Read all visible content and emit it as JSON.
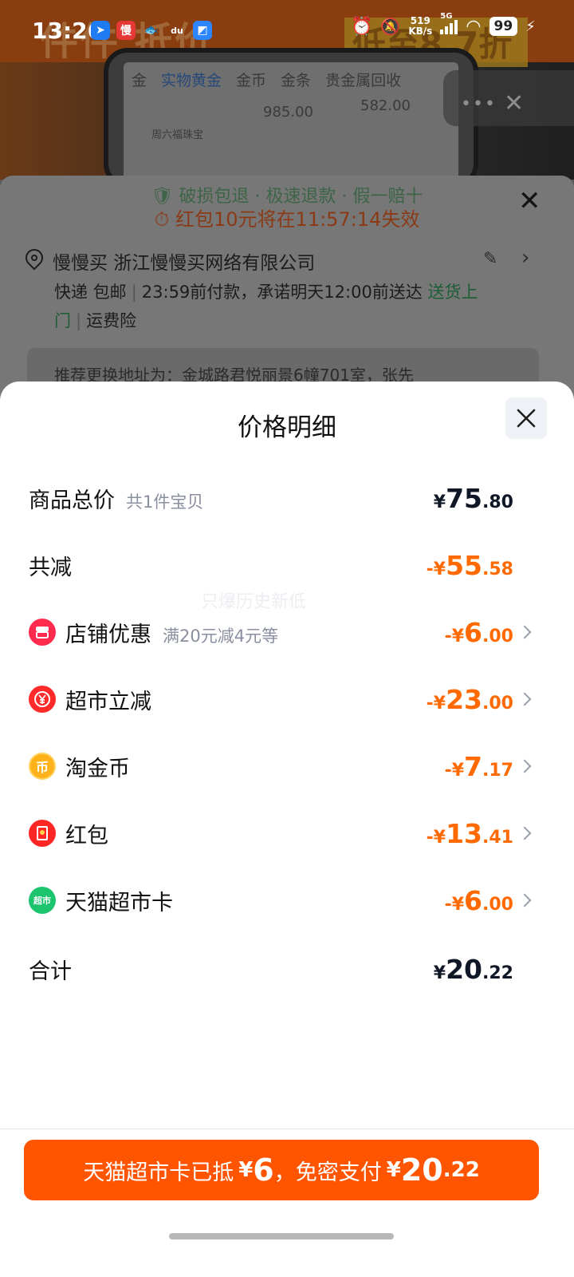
{
  "status_bar": {
    "time": "13:26",
    "net_speed_value": "519",
    "net_speed_unit": "KB/s",
    "network": "5G",
    "battery": "99",
    "app_icons": [
      "app-blue-icon",
      "man-man-mai-icon",
      "xianyu-icon",
      "du-icon",
      "blue-square-icon"
    ],
    "app_icon_texts": [
      "",
      "慢",
      "",
      "du",
      ""
    ]
  },
  "background": {
    "promo_left": "件件 抵价",
    "promo_right": "低至8.7折",
    "phone_tabs": [
      "金",
      "实物黄金",
      "金币",
      "金条",
      "贵金属回收"
    ],
    "phone_num1": "985.00",
    "phone_num2": "582.00",
    "phone_small": "周六福珠宝",
    "guarantee": "破损包退 · 极速退款 · 假一赔十",
    "timer": "红包10元将在11:57:14失效",
    "address": "慢慢买 浙江慢慢买网络有限公司",
    "delivery": {
      "carrier": "快递 包邮",
      "promise": "23:59前付款，承诺明天12:00前送达",
      "door_delivery": "送货上门",
      "insurance": "运费险"
    },
    "suggestion": "推荐更换地址为：金城路君悦丽景6幢701室，张先"
  },
  "sheet": {
    "title": "价格明细",
    "watermark": "只爆历史新低",
    "rows": [
      {
        "label": "商品总价",
        "sub": "共1件宝贝",
        "sign": "",
        "symbol": "¥",
        "int": "75",
        "dec": ".80"
      },
      {
        "label": "共减",
        "sub": "",
        "sign": "-",
        "symbol": "¥",
        "int": "55",
        "dec": ".58"
      },
      {
        "label": "店铺优惠",
        "sub": "满20元减4元等",
        "sign": "-",
        "symbol": "¥",
        "int": "6",
        "dec": ".00",
        "icon": "shop-icon"
      },
      {
        "label": "超市立减",
        "sub": "",
        "sign": "-",
        "symbol": "¥",
        "int": "23",
        "dec": ".00",
        "icon": "yuan-coupon-icon"
      },
      {
        "label": "淘金币",
        "sub": "",
        "sign": "-",
        "symbol": "¥",
        "int": "7",
        "dec": ".17",
        "icon": "taojinbi-coin-icon",
        "icon_text": "币"
      },
      {
        "label": "红包",
        "sub": "",
        "sign": "-",
        "symbol": "¥",
        "int": "13",
        "dec": ".41",
        "icon": "red-packet-icon"
      },
      {
        "label": "天猫超市卡",
        "sub": "",
        "sign": "-",
        "symbol": "¥",
        "int": "6",
        "dec": ".00",
        "icon": "tmall-supermarket-card-icon",
        "icon_text": "超市"
      },
      {
        "label": "合计",
        "sub": "",
        "sign": "",
        "symbol": "¥",
        "int": "20",
        "dec": ".22"
      }
    ]
  },
  "pay_button": {
    "prefix": "天猫超市卡已抵",
    "card_symbol": "¥",
    "card_amount": "6",
    "middle": "，免密支付",
    "pay_symbol": "¥",
    "pay_int": "20",
    "pay_dec": ".22"
  },
  "colors": {
    "accent_orange": "#ff5500",
    "amount_orange": "#ff6a00",
    "dark_text": "#101828"
  }
}
